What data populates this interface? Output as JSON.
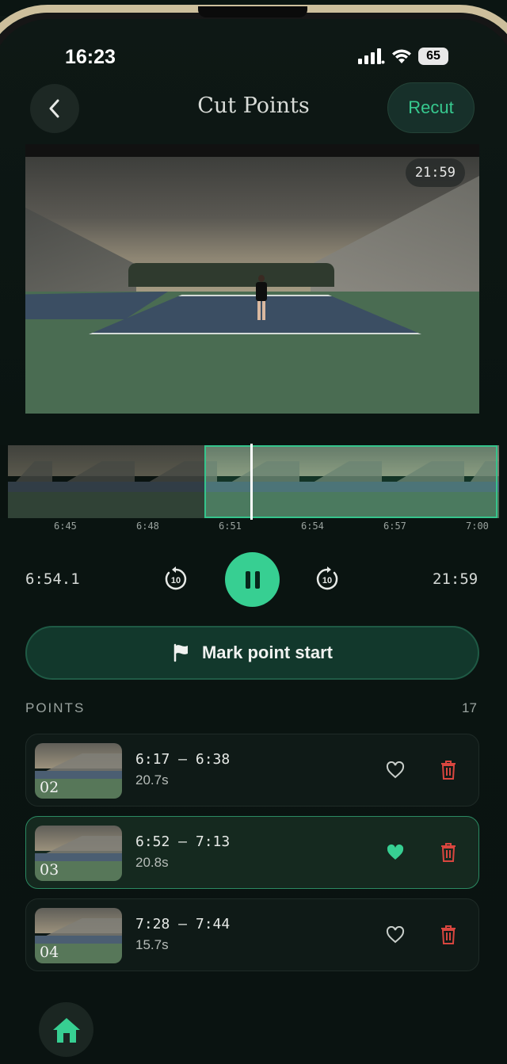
{
  "status_bar": {
    "time": "16:23",
    "battery": "65"
  },
  "header": {
    "title": "Cut Points",
    "recut_label": "Recut"
  },
  "video": {
    "timestamp": "21:59"
  },
  "timeline": {
    "ticks": [
      "6:45",
      "6:48",
      "6:51",
      "6:54",
      "6:57",
      "7:00"
    ]
  },
  "playback": {
    "current_time": "6:54.1",
    "total_time": "21:59",
    "skip_seconds": "10"
  },
  "mark_button": {
    "label": "Mark point start"
  },
  "points": {
    "label": "POINTS",
    "count": "17",
    "items": [
      {
        "number": "02",
        "range": "6:17 – 6:38",
        "duration": "20.7s",
        "favorite": false
      },
      {
        "number": "03",
        "range": "6:52 – 7:13",
        "duration": "20.8s",
        "favorite": true
      },
      {
        "number": "04",
        "range": "7:28 – 7:44",
        "duration": "15.7s",
        "favorite": false
      }
    ]
  },
  "colors": {
    "accent": "#37cf92",
    "delete": "#d9463f",
    "background": "#0b1512"
  }
}
